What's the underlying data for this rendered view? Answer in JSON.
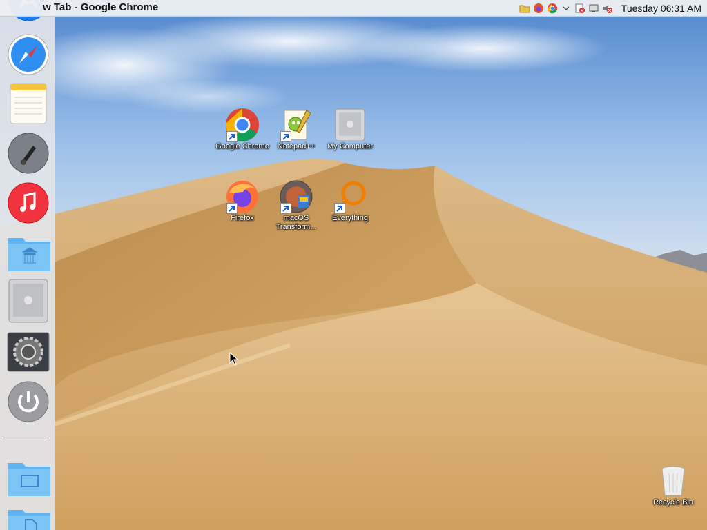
{
  "menubar": {
    "window_title": "w Tab - Google Chrome",
    "tray_icons": [
      "folder-icon",
      "firefox-icon",
      "chrome-icon",
      "chevron-down-icon",
      "network-error-icon",
      "display-icon",
      "volume-muted-icon"
    ],
    "clock": "Tuesday 06:31 AM"
  },
  "dock": {
    "items": [
      "app-store-icon",
      "safari-icon",
      "notes-icon",
      "launchpad-icon",
      "music-icon",
      "library-folder-icon",
      "my-computer-icon",
      "system-preferences-icon",
      "power-icon",
      "desktop-folder-icon",
      "documents-folder-icon"
    ]
  },
  "desktop": {
    "icons": [
      {
        "name": "google-chrome",
        "label": "Google Chrome",
        "shortcut": true
      },
      {
        "name": "notepad-plus-plus",
        "label": "Notepad++",
        "shortcut": true
      },
      {
        "name": "my-computer",
        "label": "My Computer",
        "shortcut": false
      },
      {
        "name": "firefox",
        "label": "Firefox",
        "shortcut": true
      },
      {
        "name": "macos-transformation",
        "label": "macOS Transform...",
        "shortcut": true
      },
      {
        "name": "everything",
        "label": "Everything",
        "shortcut": true
      },
      {
        "name": "recycle-bin",
        "label": "Recycle Bin",
        "shortcut": false
      }
    ]
  },
  "colors": {
    "sky_top": "#5f93d2",
    "sand": "#cfa468",
    "menubar": "#eceef2",
    "dock": "#e2e4e8"
  }
}
